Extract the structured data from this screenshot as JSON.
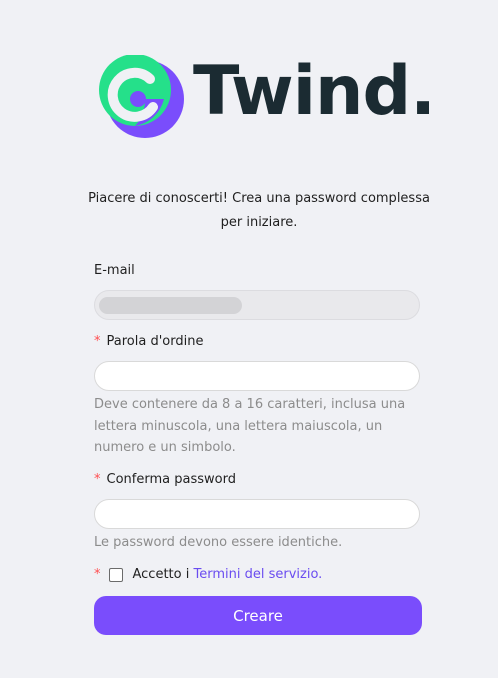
{
  "logo": {
    "wordmark": "Twind.",
    "icon": "twind-swirl-logo-icon",
    "colors": {
      "green": "#25e08a",
      "purple": "#7a4dfc",
      "text": "#1b2b32"
    }
  },
  "intro": "Piacere di conoscerti! Crea una password complessa per iniziare.",
  "email": {
    "label": "E-mail",
    "value": ""
  },
  "password": {
    "label": "Parola d'ordine",
    "value": "",
    "help": "Deve contenere da 8 a 16 caratteri, inclusa una lettera minuscola, una lettera maiuscola, un numero e un simbolo."
  },
  "confirm": {
    "label": "Conferma password",
    "value": "",
    "help": "Le password devono essere identiche."
  },
  "terms": {
    "prefix": "Accetto i",
    "link": "Termini del servizio."
  },
  "submit_label": "Creare",
  "required_mark": "*",
  "accent": "#7a4dfc",
  "error_color": "#ff4d4f"
}
